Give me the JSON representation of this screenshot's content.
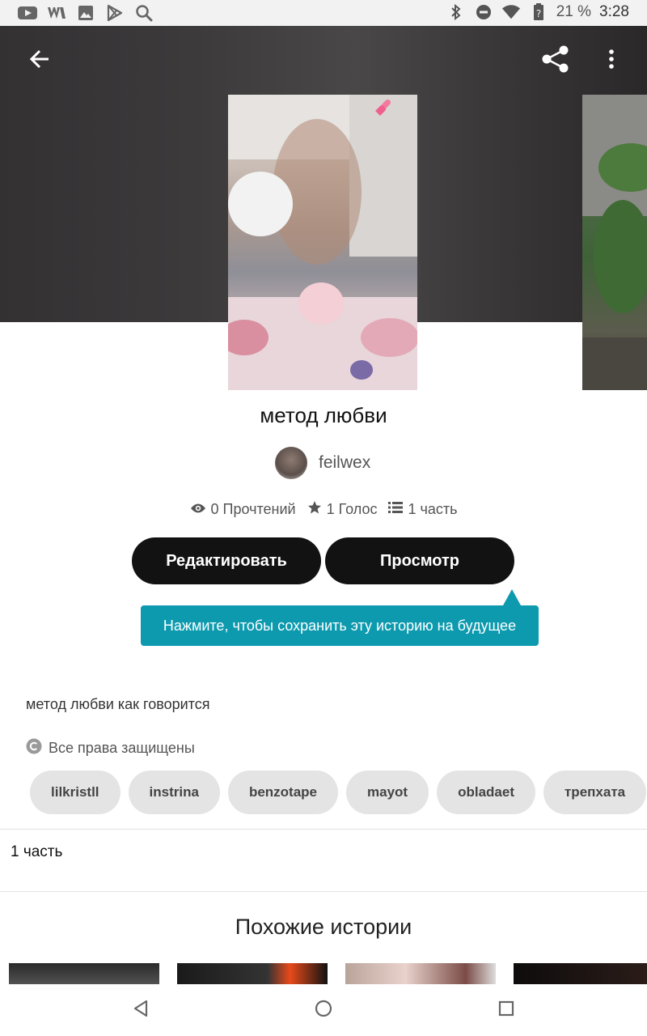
{
  "status_bar": {
    "battery_pct": "21 %",
    "time": "3:28",
    "left_icons": [
      "youtube-icon",
      "wattpad-icon",
      "image-icon",
      "play-store-icon",
      "search-icon"
    ],
    "right_icons": [
      "bluetooth-icon",
      "dnd-icon",
      "wifi-icon",
      "battery-icon"
    ]
  },
  "header": {
    "back_icon": "arrow-left-icon",
    "share_icon": "share-icon",
    "menu_icon": "more-vertical-icon"
  },
  "story": {
    "title": "метод любви",
    "author": "feilwex",
    "reads": "0 Прочтений",
    "votes": "1 Голос",
    "parts": "1 часть"
  },
  "actions": {
    "edit_label": "Редактировать",
    "view_label": "Просмотр"
  },
  "tooltip": {
    "text": "Нажмите, чтобы сохранить эту историю на будущее"
  },
  "description": "метод любви как говорится",
  "copyright": "Все права защищены",
  "tags": [
    "lilkristll",
    "instrina",
    "benzotape",
    "mayot",
    "obladaet",
    "трепхата"
  ],
  "parts_section": {
    "label": "1 часть"
  },
  "similar": {
    "heading": "Похожие истории"
  },
  "colors": {
    "accent": "#0d9aaf",
    "button": "#121212",
    "tag_bg": "#e4e4e4"
  }
}
